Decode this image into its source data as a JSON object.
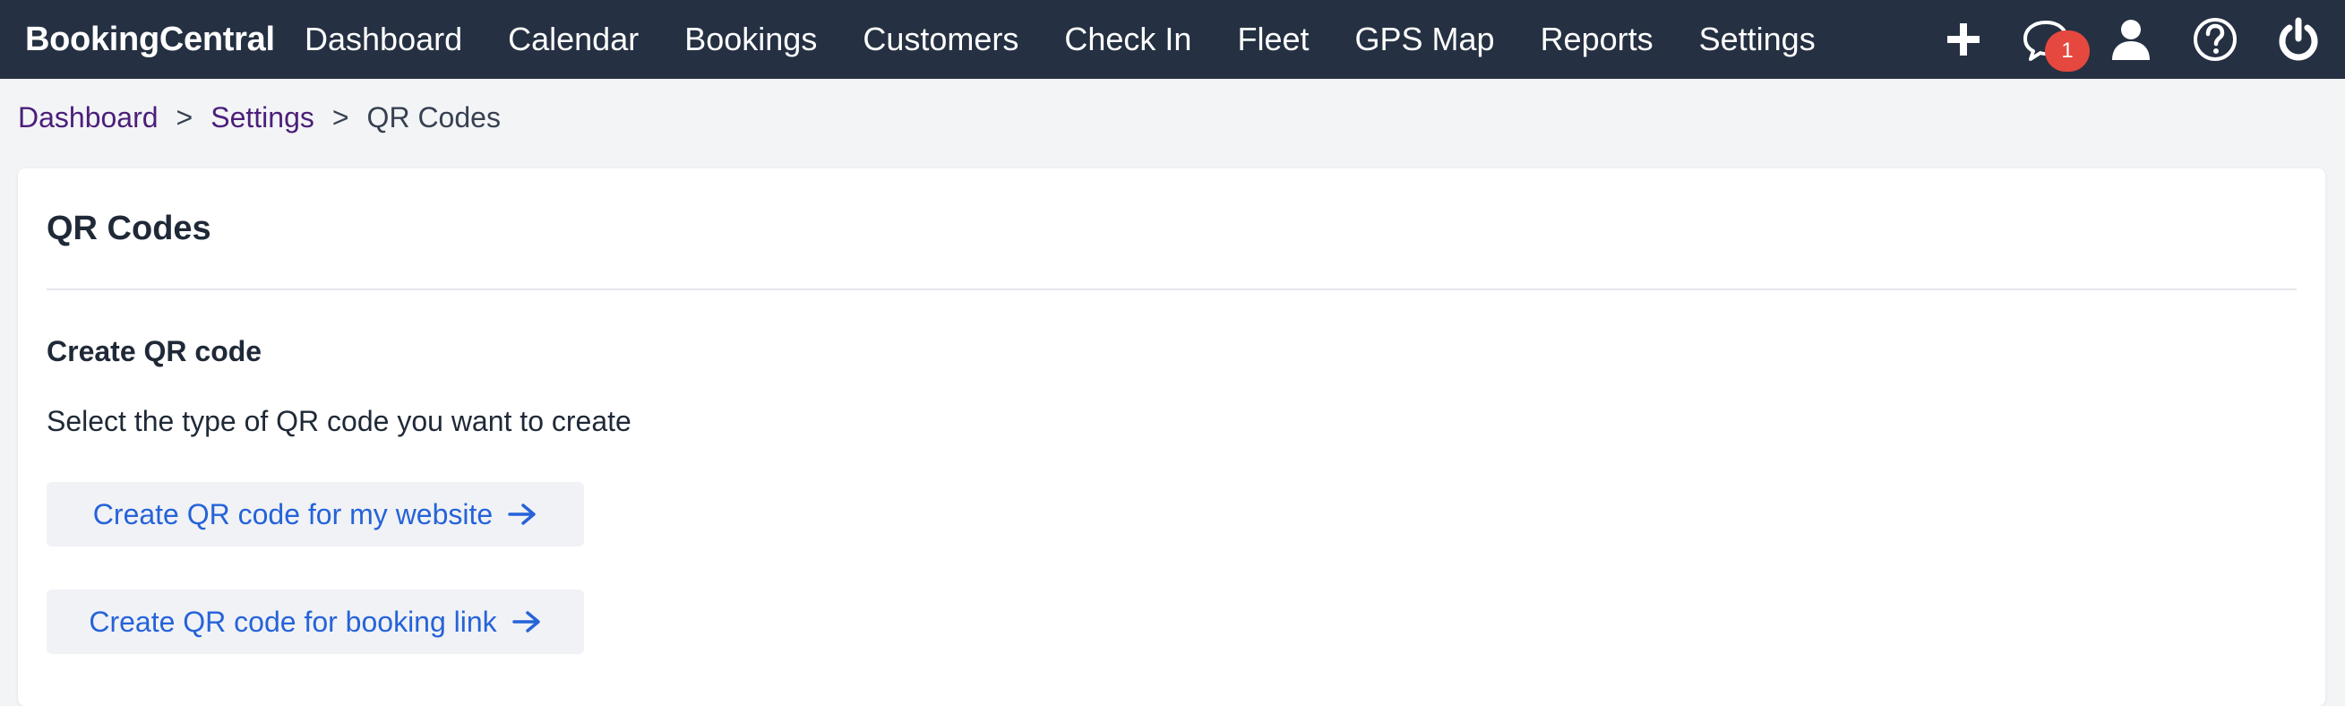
{
  "brand": "BookingCentral",
  "nav": {
    "items": [
      "Dashboard",
      "Calendar",
      "Bookings",
      "Customers",
      "Check In",
      "Fleet",
      "GPS Map",
      "Reports",
      "Settings"
    ],
    "icons": [
      "plus-icon",
      "chat-icon",
      "user-icon",
      "help-icon",
      "power-icon"
    ],
    "notification_count": "1"
  },
  "breadcrumb": {
    "items": [
      "Dashboard",
      "Settings"
    ],
    "separator": ">",
    "current": "QR Codes"
  },
  "card": {
    "title": "QR Codes",
    "section_title": "Create QR code",
    "description": "Select the type of QR code you want to create",
    "buttons": {
      "website": "Create QR code for my website",
      "booking": "Create QR code for booking link"
    }
  },
  "colors": {
    "navbar": "#253042",
    "link": "#4b1f7a",
    "button_text": "#2563d9",
    "badge": "#e5483e"
  }
}
